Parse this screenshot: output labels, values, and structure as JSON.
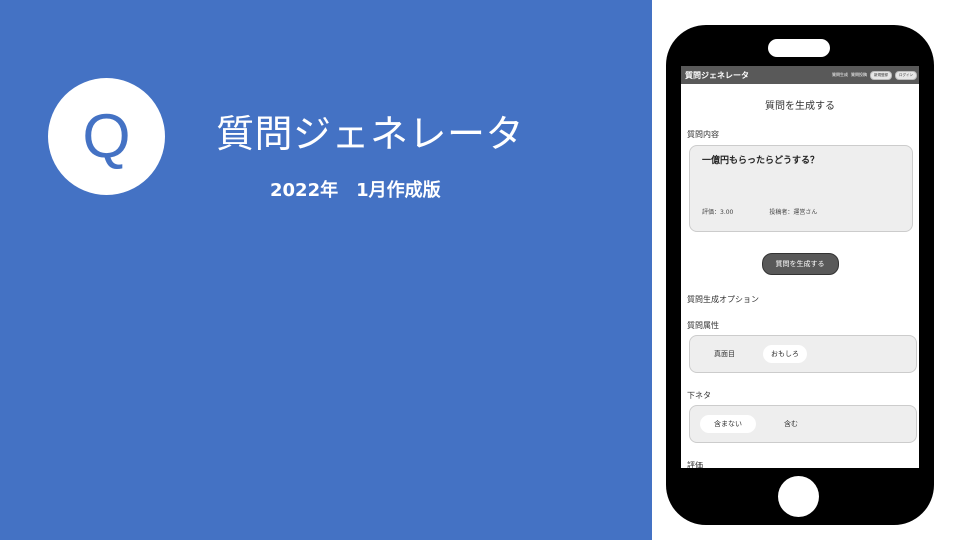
{
  "slide": {
    "icon_letter": "Q",
    "title": "質問ジェネレータ",
    "subtitle": "2022年　1月作成版"
  },
  "app": {
    "header": {
      "title": "質問ジェネレータ",
      "nav": [
        "質問生成",
        "質問投稿"
      ],
      "buttons": [
        "新規登録",
        "ログイン"
      ]
    },
    "section_title": "質問を生成する",
    "content_label": "質問内容",
    "question": {
      "text": "一億円もらったらどうする？",
      "rating": "評価：3.00",
      "poster": "投稿者：運営さん"
    },
    "generate_button": "質問を生成する",
    "options_heading": "質問生成オプション",
    "attribute": {
      "label": "質問属性",
      "options": [
        "真面目",
        "おもしろ"
      ],
      "selected": "おもしろ"
    },
    "shimoneta": {
      "label": "下ネタ",
      "options": [
        "含まない",
        "含む"
      ],
      "selected": "含まない"
    },
    "rating_label": "評価"
  },
  "colors": {
    "panel_blue": "#4472c4",
    "header_gray": "#595959",
    "card_gray": "#eeeeee"
  }
}
